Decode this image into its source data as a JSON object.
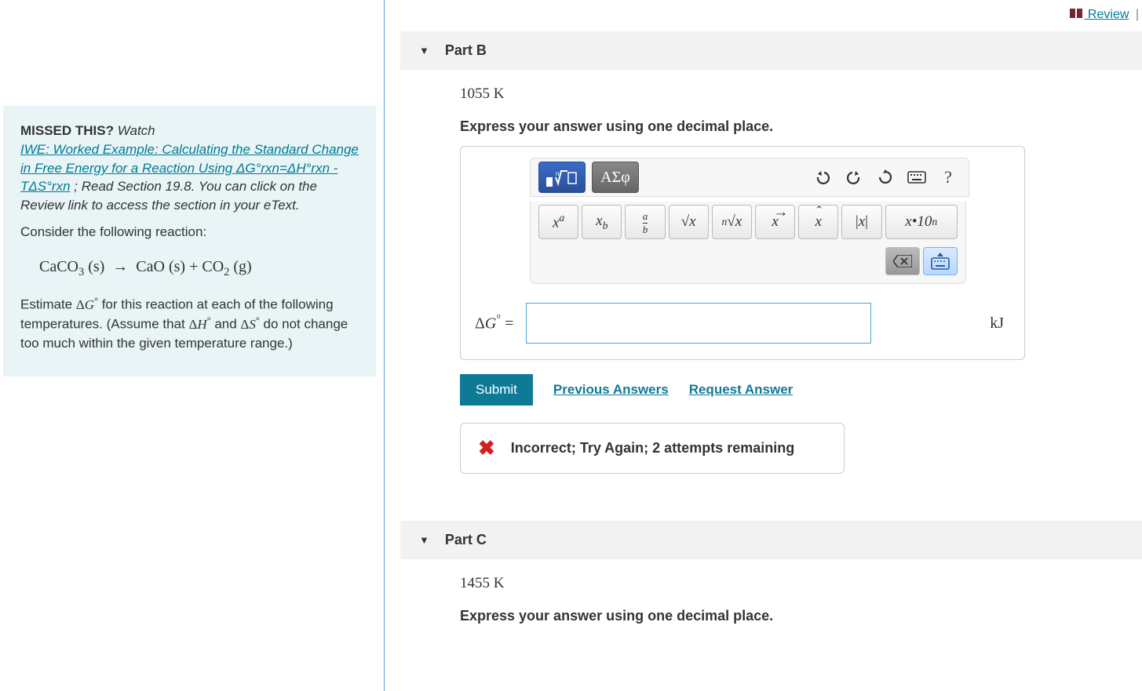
{
  "topnav": {
    "review_label": " Review",
    "separator": "|"
  },
  "hint": {
    "missed_label": "MISSED THIS?",
    "watch_label": "Watch",
    "link_text": "IWE: Worked Example: Calculating the Standard Change in Free Energy for a Reaction Using ΔG°rxn=ΔH°rxn - TΔS°rxn",
    "read_text": "; Read Section 19.8. You can click on the Review link to access the section in your eText.",
    "consider": "Consider the following reaction:",
    "reaction_html": "CaCO₃ (s)  →  CaO (s) + CO₂ (g)",
    "estimate_prefix": "Estimate ",
    "deltaG": "ΔG°",
    "estimate_mid": " for this reaction at each of the following temperatures. (Assume that ",
    "deltaH": "ΔH°",
    "and": " and ",
    "deltaS": "ΔS°",
    "estimate_suffix": " do not change too much within the given temperature range.)"
  },
  "parts": {
    "b": {
      "title": "Part B",
      "temperature": "1055 K",
      "instruction": "Express your answer using one decimal place.",
      "lhs": "ΔG° =",
      "unit": "kJ",
      "input_value": "",
      "submit": "Submit",
      "prev": "Previous Answers",
      "request": "Request Answer",
      "feedback": "Incorrect; Try Again; 2 attempts remaining"
    },
    "c": {
      "title": "Part C",
      "temperature": "1455 K",
      "instruction": "Express your answer using one decimal place."
    }
  },
  "toolbar": {
    "templates_label": "▯√▯",
    "greek_label": "ΑΣφ",
    "help_label": "?",
    "math_buttons": [
      "xᵃ",
      "xᵦ",
      "a⁄b",
      "√x",
      "ⁿ√x",
      "x⃗",
      "x̂",
      "|x|",
      "x·10ⁿ"
    ]
  }
}
